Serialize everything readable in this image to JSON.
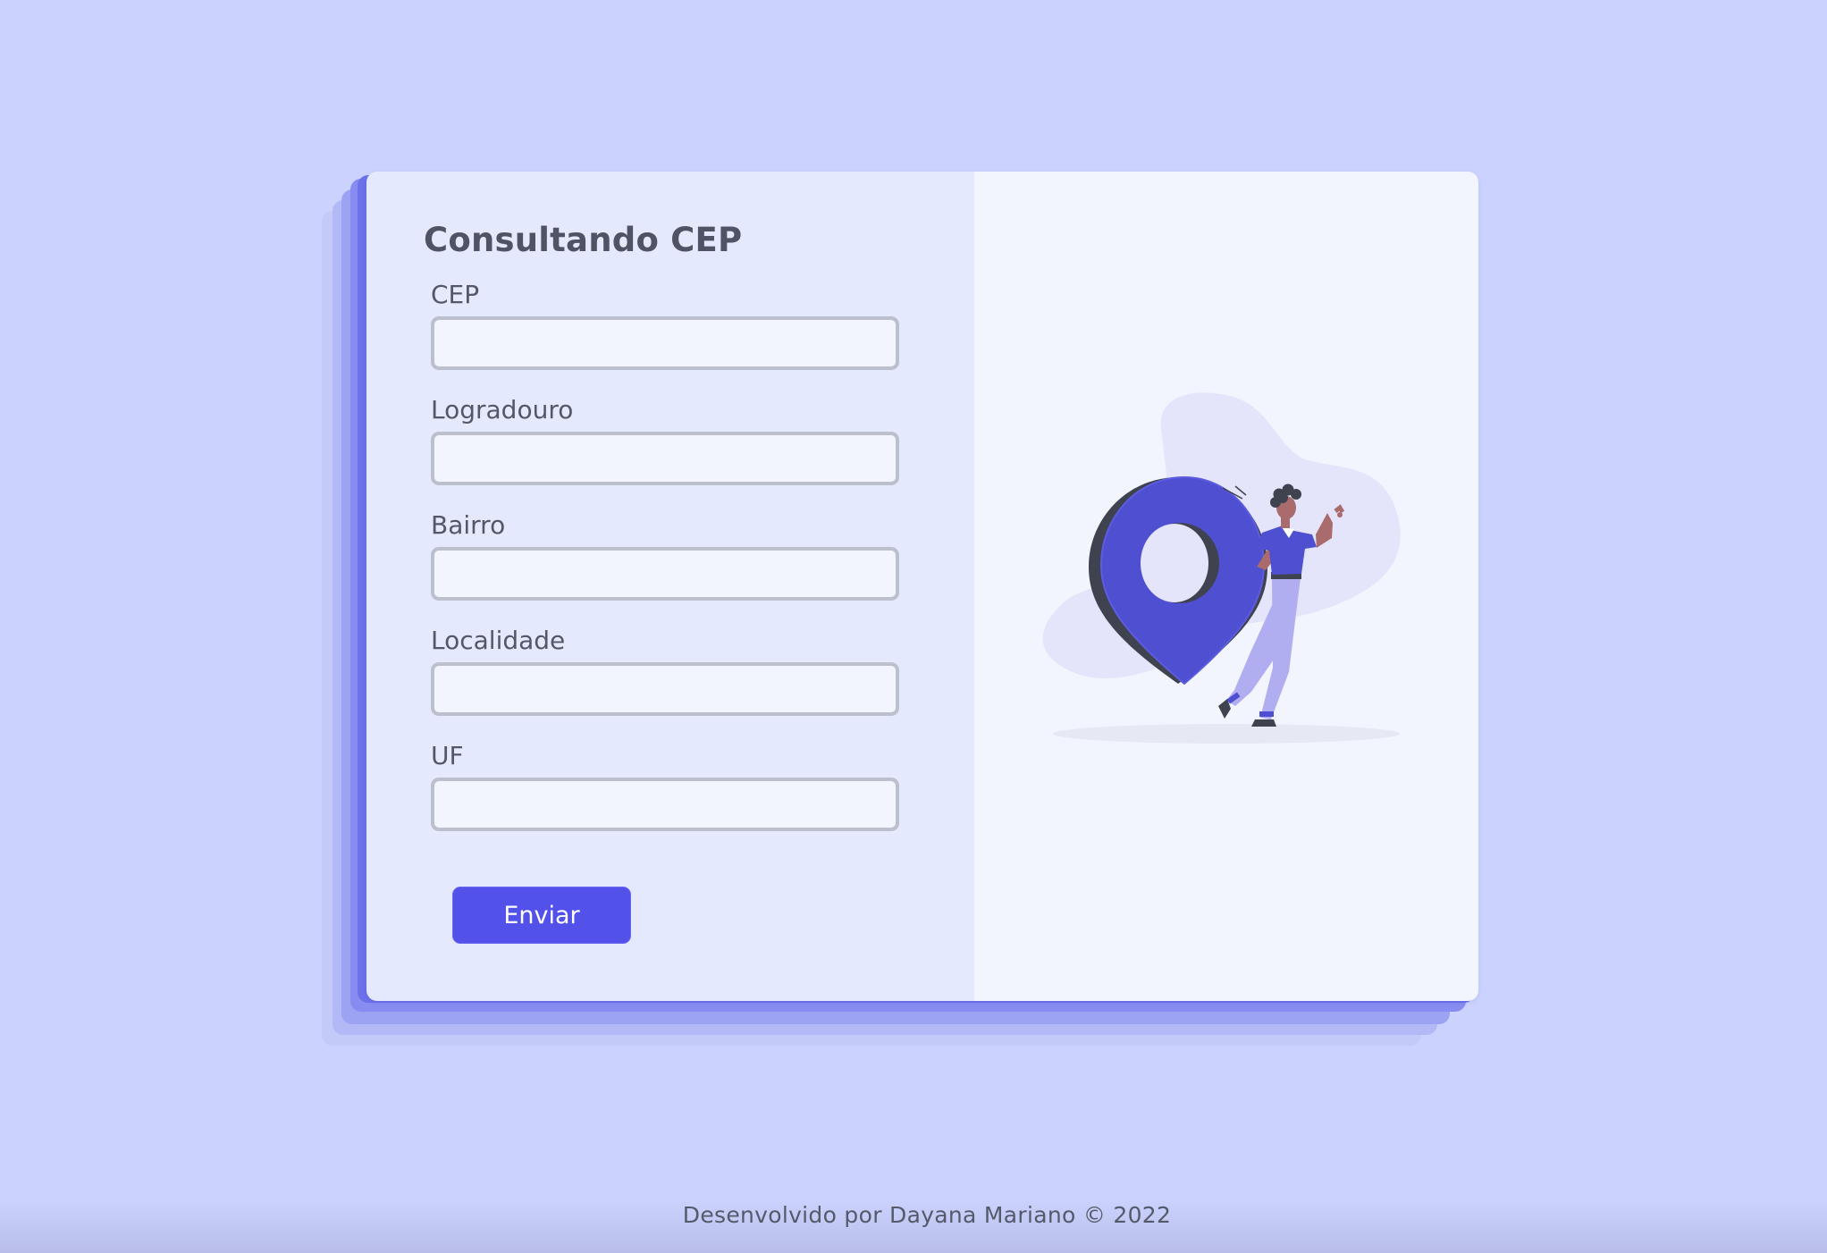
{
  "form": {
    "title": "Consultando CEP",
    "fields": [
      {
        "label": "CEP",
        "value": "",
        "placeholder": ""
      },
      {
        "label": "Logradouro",
        "value": "",
        "placeholder": ""
      },
      {
        "label": "Bairro",
        "value": "",
        "placeholder": ""
      },
      {
        "label": "Localidade",
        "value": "",
        "placeholder": ""
      },
      {
        "label": "UF",
        "value": "",
        "placeholder": ""
      }
    ],
    "submit_label": "Enviar"
  },
  "illustration": {
    "icon": "location-pin-icon"
  },
  "footer": {
    "text": "Desenvolvido por Dayana Mariano © 2022"
  },
  "colors": {
    "page_background": "#cbd2fd",
    "form_background": "#e5e9fd",
    "illustration_background": "#f3f5fe",
    "accent": "#5251ea",
    "pin": "#4f4fd1",
    "text": "#4f5363"
  }
}
